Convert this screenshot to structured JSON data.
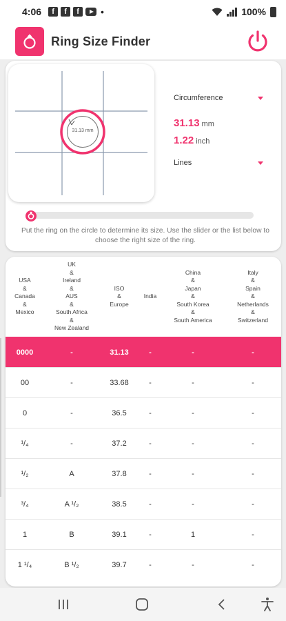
{
  "status_bar": {
    "time": "4:06",
    "notification_icons": [
      "facebook-icon",
      "facebook-icon",
      "facebook-icon",
      "youtube-icon"
    ],
    "battery": "100%"
  },
  "app": {
    "title": "Ring Size Finder",
    "accent_color": "#f0336e"
  },
  "measure": {
    "circle_label": "31.13 mm",
    "mode_dropdown": "Circumference",
    "value_mm": "31.13",
    "unit_mm": "mm",
    "value_inch": "1.22",
    "unit_inch": "inch",
    "guide_dropdown": "Lines",
    "instructions": "Put the ring on the circle to determine its size. Use the slider or the list below to choose the right size of the ring."
  },
  "table": {
    "headers": [
      "USA\n&\nCanada\n&\nMexico",
      "UK\n&\nIreland\n&\nAUS\n&\nSouth Africa\n&\nNew Zealand",
      "ISO\n&\nEurope",
      "India",
      "China\n&\nJapan\n&\nSouth Korea\n&\nSouth America",
      "Italy\n&\nSpain\n&\nNetherlands\n&\nSwitzerland"
    ],
    "rows": [
      {
        "usa": "0000",
        "uk": "-",
        "iso": "31.13",
        "india": "-",
        "china": "-",
        "italy": "-",
        "selected": true
      },
      {
        "usa": "00",
        "uk": "-",
        "iso": "33.68",
        "india": "-",
        "china": "-",
        "italy": "-",
        "selected": false
      },
      {
        "usa": "0",
        "uk": "-",
        "iso": "36.5",
        "india": "-",
        "china": "-",
        "italy": "-",
        "selected": false
      },
      {
        "usa": "¹/₄",
        "uk": "-",
        "iso": "37.2",
        "india": "-",
        "china": "-",
        "italy": "-",
        "selected": false
      },
      {
        "usa": "¹/₂",
        "uk": "A",
        "iso": "37.8",
        "india": "-",
        "china": "-",
        "italy": "-",
        "selected": false
      },
      {
        "usa": "³/₄",
        "uk": "A ¹/₂",
        "iso": "38.5",
        "india": "-",
        "china": "-",
        "italy": "-",
        "selected": false
      },
      {
        "usa": "1",
        "uk": "B",
        "iso": "39.1",
        "india": "-",
        "china": "1",
        "italy": "-",
        "selected": false
      },
      {
        "usa": "1 ¹/₄",
        "uk": "B ¹/₂",
        "iso": "39.7",
        "india": "-",
        "china": "-",
        "italy": "-",
        "selected": false
      }
    ]
  },
  "nav_bar": {
    "buttons": [
      "recent-apps-icon",
      "home-icon",
      "back-icon",
      "accessibility-icon"
    ]
  }
}
